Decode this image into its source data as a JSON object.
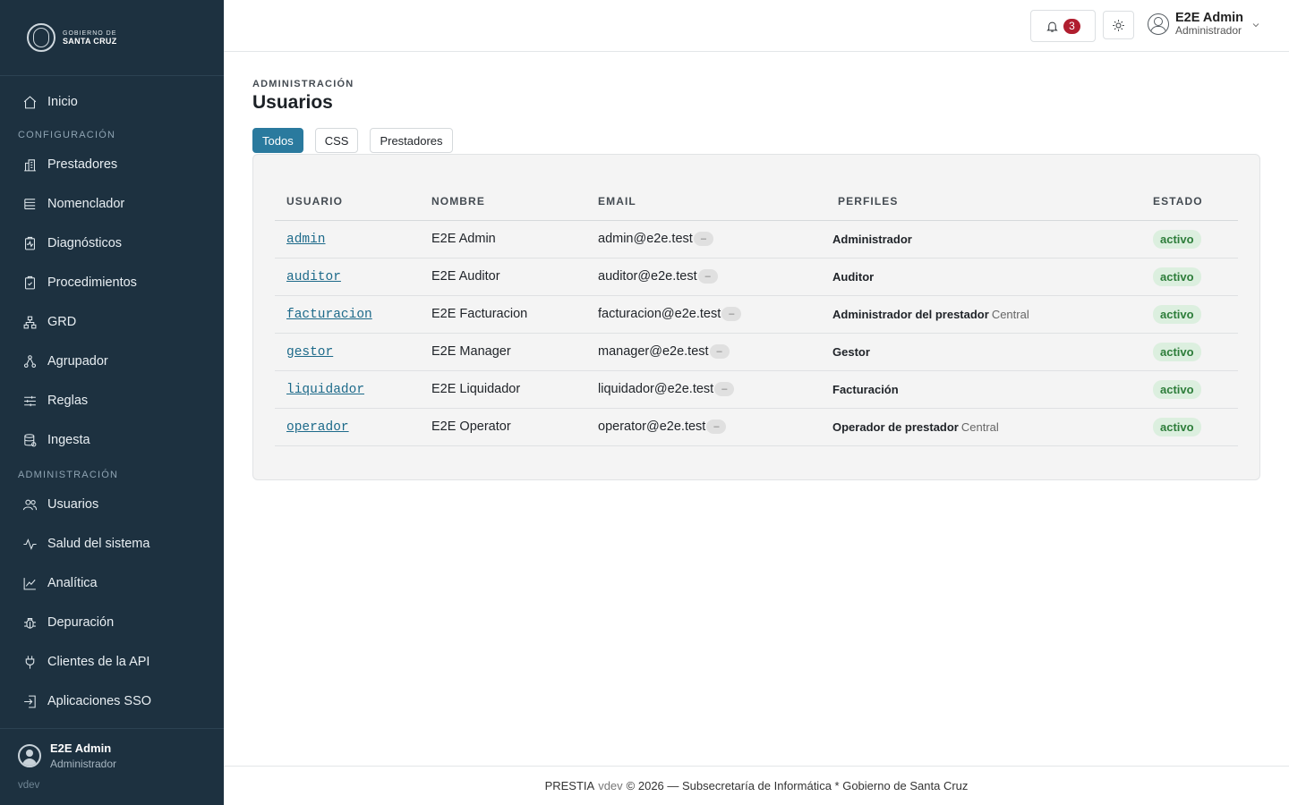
{
  "brand": {
    "line1": "GOBIERNO DE",
    "line2": "SANTA CRUZ"
  },
  "nav": {
    "home": "Inicio",
    "section_config": "CONFIGURACIÓN",
    "config_items": [
      "Prestadores",
      "Nomenclador",
      "Diagnósticos",
      "Procedimientos",
      "GRD",
      "Agrupador",
      "Reglas",
      "Ingesta"
    ],
    "section_admin": "ADMINISTRACIÓN",
    "admin_items": [
      "Usuarios",
      "Salud del sistema",
      "Analítica",
      "Depuración",
      "Clientes de la API",
      "Aplicaciones SSO"
    ]
  },
  "sidebar_user": {
    "name": "E2E Admin",
    "role": "Administrador",
    "version": "vdev"
  },
  "header": {
    "notifications_count": "3",
    "user_name": "E2E Admin",
    "user_role": "Administrador"
  },
  "page": {
    "eyebrow": "ADMINISTRACIÓN",
    "title": "Usuarios",
    "filters": [
      "Todos",
      "CSS",
      "Prestadores"
    ],
    "active_filter": "Todos"
  },
  "table": {
    "headers": [
      "USUARIO",
      "NOMBRE",
      "EMAIL",
      "PERFILES",
      "ESTADO"
    ],
    "rows": [
      {
        "user": "admin",
        "name": "E2E Admin",
        "email": "admin@e2e.test",
        "email_badge": "–",
        "profile": "Administrador",
        "profile_sub": "",
        "status": "activo"
      },
      {
        "user": "auditor",
        "name": "E2E Auditor",
        "email": "auditor@e2e.test",
        "email_badge": "–",
        "profile": "Auditor",
        "profile_sub": "",
        "status": "activo"
      },
      {
        "user": "facturacion",
        "name": "E2E Facturacion",
        "email": "facturacion@e2e.test",
        "email_badge": "–",
        "profile": "Administrador del prestador",
        "profile_sub": "Central",
        "status": "activo"
      },
      {
        "user": "gestor",
        "name": "E2E Manager",
        "email": "manager@e2e.test",
        "email_badge": "–",
        "profile": "Gestor",
        "profile_sub": "",
        "status": "activo"
      },
      {
        "user": "liquidador",
        "name": "E2E Liquidador",
        "email": "liquidador@e2e.test",
        "email_badge": "–",
        "profile": "Facturación",
        "profile_sub": "",
        "status": "activo"
      },
      {
        "user": "operador",
        "name": "E2E Operator",
        "email": "operator@e2e.test",
        "email_badge": "–",
        "profile": "Operador de prestador",
        "profile_sub": "Central",
        "status": "activo"
      }
    ]
  },
  "footer": {
    "app": "PRESTIA",
    "version": "vdev",
    "rest": "© 2026 — Subsecretaría de Informática * Gobierno de Santa Cruz"
  },
  "colors": {
    "sidebar_bg": "#1d3140",
    "accent": "#2a7a9e",
    "link": "#1d6a8a",
    "status_bg": "#dcefdf",
    "status_text": "#2d7d3a",
    "badge": "#b01e2f"
  }
}
